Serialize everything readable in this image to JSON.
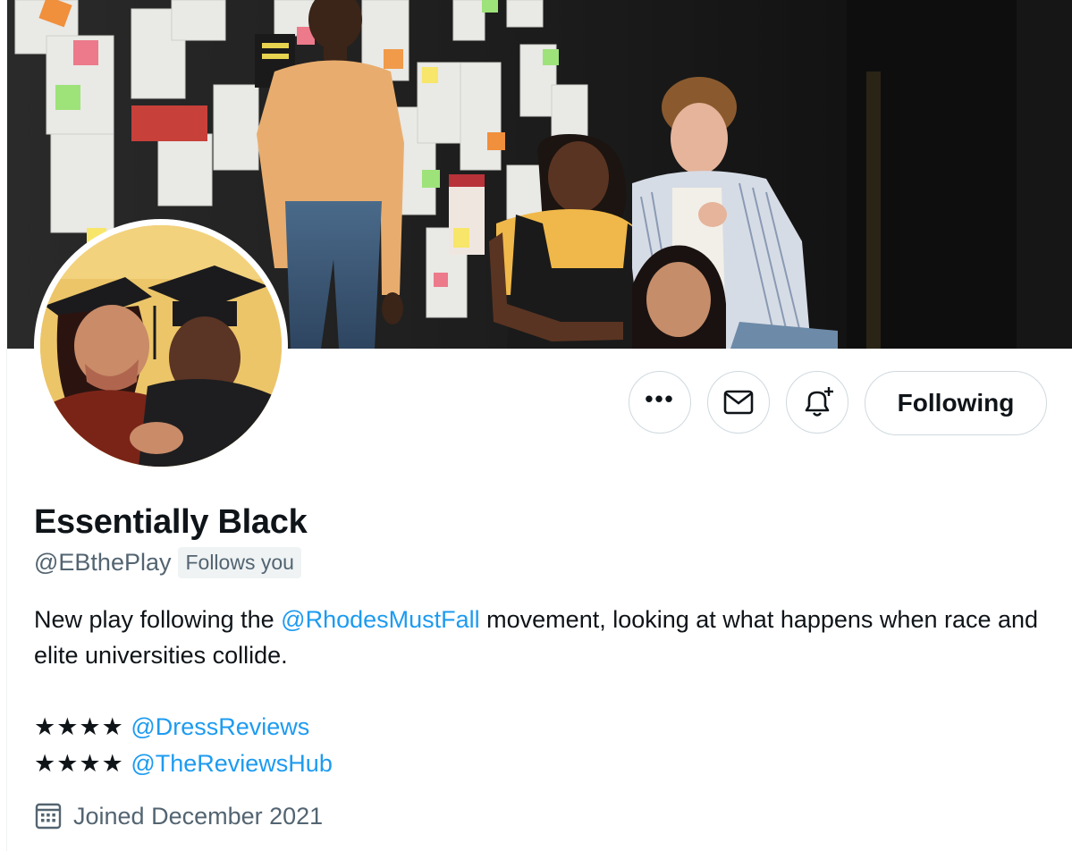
{
  "profile": {
    "display_name": "Essentially Black",
    "handle": "@EBthePlay",
    "follows_you": "Follows you",
    "bio_prefix": "New play following the ",
    "bio_mention": "@RhodesMustFall",
    "bio_suffix": " movement, looking at what happens when race and elite universities collide.",
    "reviews": [
      {
        "stars": "★★★★",
        "mention": "@DressReviews"
      },
      {
        "stars": "★★★★",
        "mention": "@TheReviewsHub"
      }
    ],
    "joined": "Joined December 2021"
  },
  "actions": {
    "more_label": "•••",
    "following_label": "Following"
  },
  "icons": {
    "more": "more-horizontal-icon",
    "message": "envelope-icon",
    "notify": "bell-plus-icon",
    "joined": "calendar-icon"
  },
  "colors": {
    "link": "#1d9bf0",
    "secondary_text": "#536471",
    "primary_text": "#0f1419",
    "border": "#cfd9de"
  }
}
